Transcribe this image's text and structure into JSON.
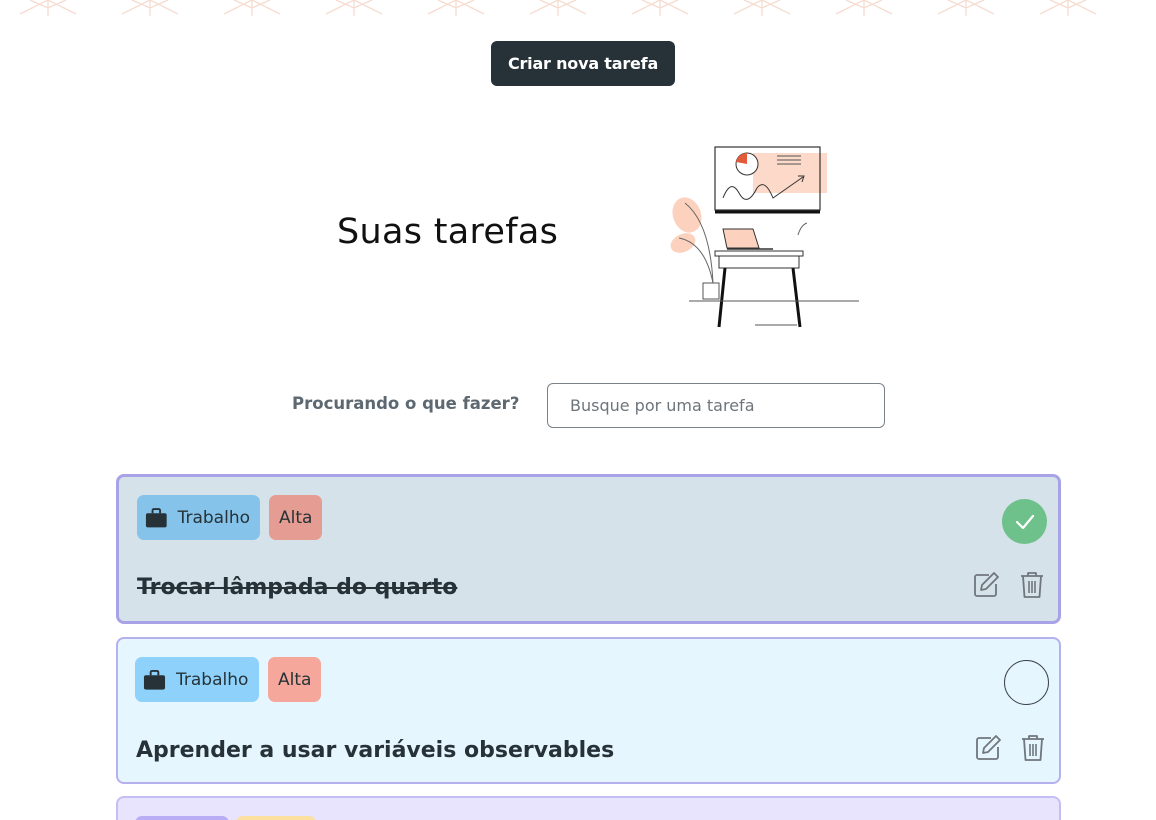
{
  "header": {
    "create_button_label": "Criar nova tarefa"
  },
  "hero": {
    "title": "Suas tarefas"
  },
  "search": {
    "label": "Procurando o que fazer?",
    "placeholder": "Busque por uma tarefa",
    "value": ""
  },
  "colors": {
    "primary_dark": "#263238",
    "work_tag": "#85c3ea",
    "high_priority_tag": "#e59c92",
    "done_check": "#6fc18c",
    "card_border": "#a8a2e6",
    "accent_peach": "#f8c9b6"
  },
  "tasks": [
    {
      "category": "Trabalho",
      "category_icon": "briefcase-icon",
      "priority": "Alta",
      "title": "Trocar lâmpada do quarto",
      "completed": true
    },
    {
      "category": "Trabalho",
      "category_icon": "briefcase-icon",
      "priority": "Alta",
      "title": "Aprender a usar variáveis observables",
      "completed": false
    }
  ],
  "icons": {
    "edit": "edit-icon",
    "delete": "trash-icon",
    "check": "check-icon"
  }
}
